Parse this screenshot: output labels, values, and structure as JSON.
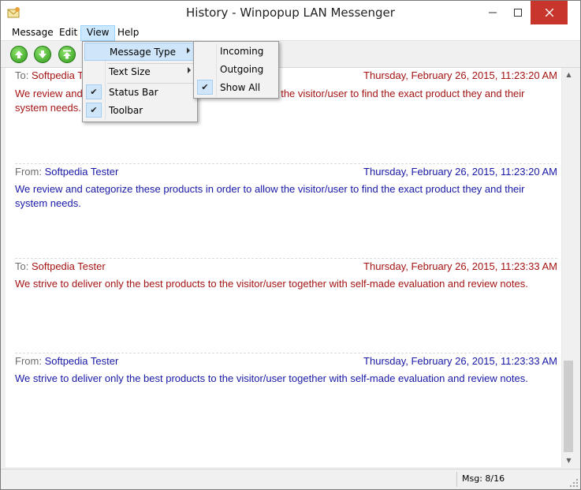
{
  "window": {
    "title": "History - Winpopup LAN Messenger"
  },
  "menubar": {
    "items": [
      "Message",
      "Edit",
      "View",
      "Help"
    ]
  },
  "view_menu": {
    "items": [
      {
        "label": "Message Type",
        "checked": false,
        "submenu": true
      },
      {
        "label": "Text Size",
        "checked": false,
        "submenu": true
      },
      {
        "label": "Status Bar",
        "checked": true,
        "submenu": false
      },
      {
        "label": "Toolbar",
        "checked": true,
        "submenu": false
      }
    ]
  },
  "message_type_menu": {
    "items": [
      {
        "label": "Incoming",
        "checked": false
      },
      {
        "label": "Outgoing",
        "checked": false
      },
      {
        "label": "Show All",
        "checked": true
      }
    ]
  },
  "toolbar": {
    "buttons": [
      "up-icon",
      "down-icon",
      "top-icon"
    ]
  },
  "messages": [
    {
      "direction": "To:",
      "name": "Softpedia Tester",
      "datetime": "Thursday, February 26, 2015, 11:23:20 AM",
      "body": "We review and categorize these products in order to allow the visitor/user to find the exact product they and their system needs.",
      "color": "#a41414"
    },
    {
      "direction": "From:",
      "name": "Softpedia Tester",
      "datetime": "Thursday, February 26, 2015, 11:23:20 AM",
      "body": "We review and categorize these products in order to allow the visitor/user to find the exact product they and their system needs.",
      "color": "#1818a6"
    },
    {
      "direction": "To:",
      "name": "Softpedia Tester",
      "datetime": "Thursday, February 26, 2015, 11:23:33 AM",
      "body": "We strive to deliver only the best products to the visitor/user together with self-made evaluation and review notes.",
      "color": "#a41414"
    },
    {
      "direction": "From:",
      "name": "Softpedia Tester",
      "datetime": "Thursday, February 26, 2015, 11:23:33 AM",
      "body": "We strive to deliver only the best products to the visitor/user together with self-made evaluation and review notes.",
      "color": "#1818a6"
    }
  ],
  "status": {
    "msg": "Msg: 8/16"
  }
}
